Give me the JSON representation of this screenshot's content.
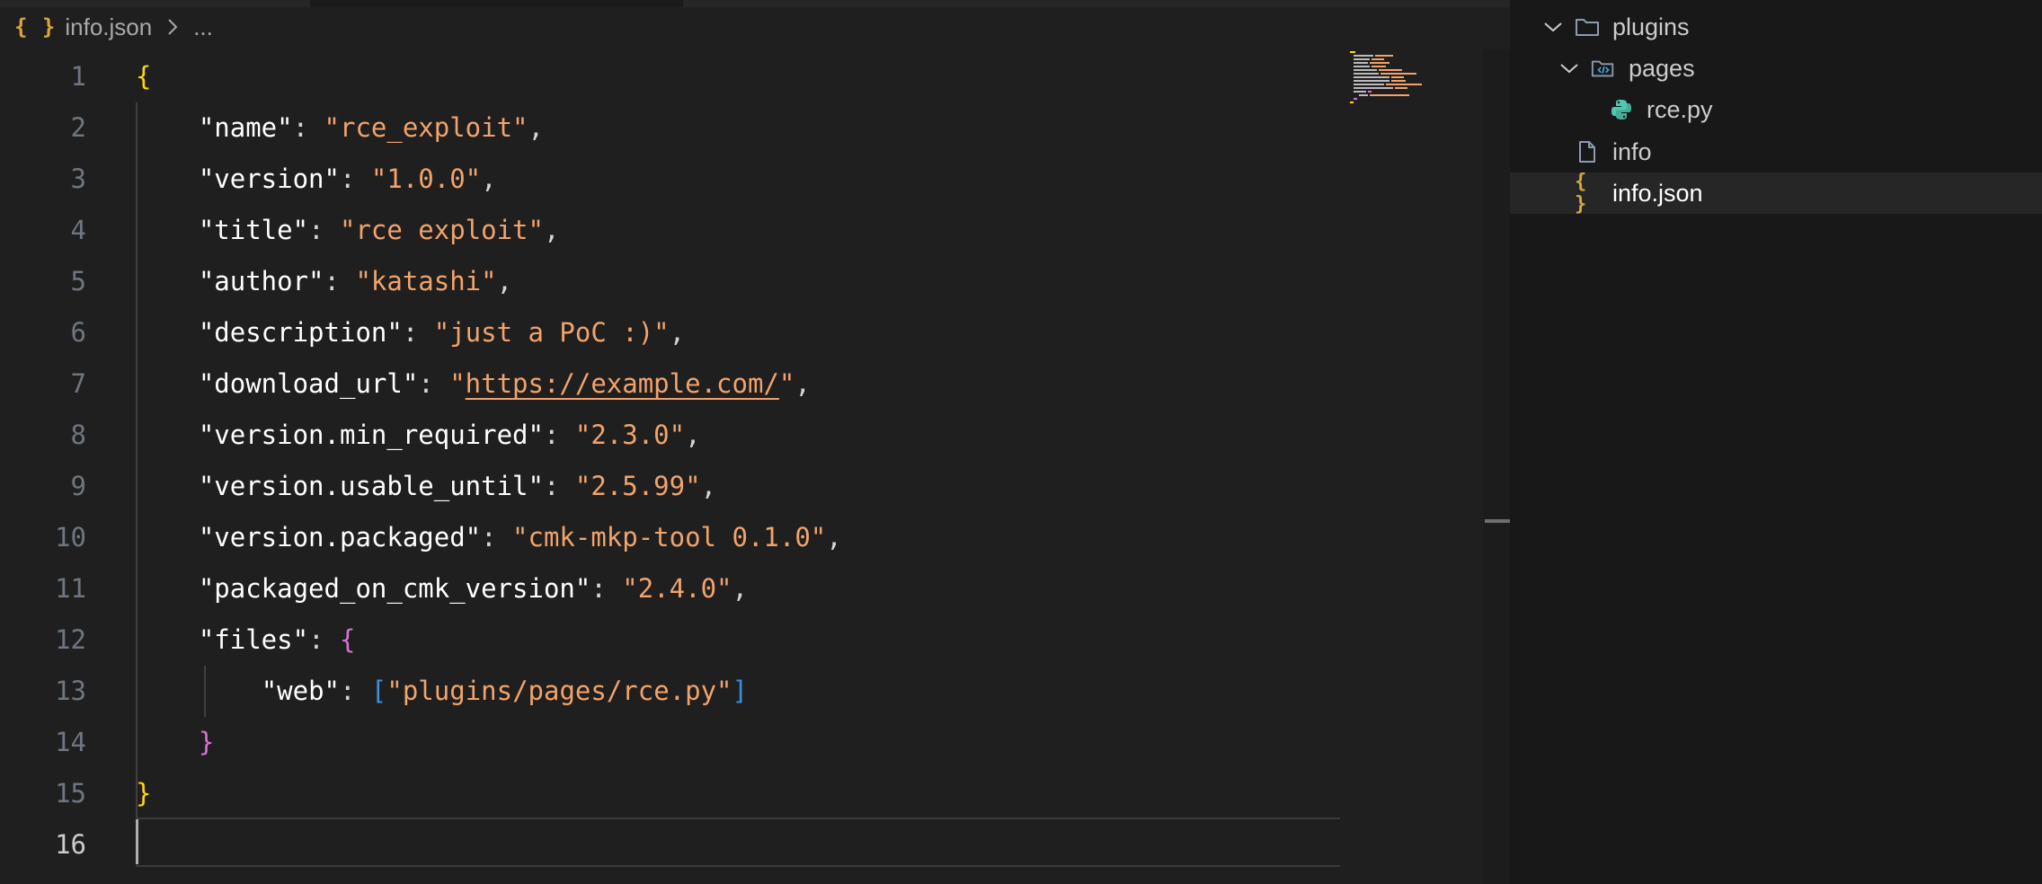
{
  "breadcrumb": {
    "file": "info.json",
    "more": "..."
  },
  "editor": {
    "line_numbers": [
      "1",
      "2",
      "3",
      "4",
      "5",
      "6",
      "7",
      "8",
      "9",
      "10",
      "11",
      "12",
      "13",
      "14",
      "15",
      "16"
    ],
    "active_line": "16",
    "lines": [
      [
        {
          "t": "{",
          "c": "b1"
        }
      ],
      [
        {
          "t": "    "
        },
        {
          "t": "\"name\"",
          "c": "k"
        },
        {
          "t": ": ",
          "c": "p"
        },
        {
          "t": "\"rce_exploit\"",
          "c": "s"
        },
        {
          "t": ",",
          "c": "p"
        }
      ],
      [
        {
          "t": "    "
        },
        {
          "t": "\"version\"",
          "c": "k"
        },
        {
          "t": ": ",
          "c": "p"
        },
        {
          "t": "\"1.0.0\"",
          "c": "s"
        },
        {
          "t": ",",
          "c": "p"
        }
      ],
      [
        {
          "t": "    "
        },
        {
          "t": "\"title\"",
          "c": "k"
        },
        {
          "t": ": ",
          "c": "p"
        },
        {
          "t": "\"rce exploit\"",
          "c": "s"
        },
        {
          "t": ",",
          "c": "p"
        }
      ],
      [
        {
          "t": "    "
        },
        {
          "t": "\"author\"",
          "c": "k"
        },
        {
          "t": ": ",
          "c": "p"
        },
        {
          "t": "\"katashi\"",
          "c": "s"
        },
        {
          "t": ",",
          "c": "p"
        }
      ],
      [
        {
          "t": "    "
        },
        {
          "t": "\"description\"",
          "c": "k"
        },
        {
          "t": ": ",
          "c": "p"
        },
        {
          "t": "\"just a PoC :)\"",
          "c": "s"
        },
        {
          "t": ",",
          "c": "p"
        }
      ],
      [
        {
          "t": "    "
        },
        {
          "t": "\"download_url\"",
          "c": "k"
        },
        {
          "t": ": ",
          "c": "p"
        },
        {
          "t": "\"",
          "c": "s"
        },
        {
          "t": "https://example.com/",
          "c": "s u",
          "link": true
        },
        {
          "t": "\"",
          "c": "s"
        },
        {
          "t": ",",
          "c": "p"
        }
      ],
      [
        {
          "t": "    "
        },
        {
          "t": "\"version.min_required\"",
          "c": "k"
        },
        {
          "t": ": ",
          "c": "p"
        },
        {
          "t": "\"2.3.0\"",
          "c": "s"
        },
        {
          "t": ",",
          "c": "p"
        }
      ],
      [
        {
          "t": "    "
        },
        {
          "t": "\"version.usable_until\"",
          "c": "k"
        },
        {
          "t": ": ",
          "c": "p"
        },
        {
          "t": "\"2.5.99\"",
          "c": "s"
        },
        {
          "t": ",",
          "c": "p"
        }
      ],
      [
        {
          "t": "    "
        },
        {
          "t": "\"version.packaged\"",
          "c": "k"
        },
        {
          "t": ": ",
          "c": "p"
        },
        {
          "t": "\"cmk-mkp-tool 0.1.0\"",
          "c": "s"
        },
        {
          "t": ",",
          "c": "p"
        }
      ],
      [
        {
          "t": "    "
        },
        {
          "t": "\"packaged_on_cmk_version\"",
          "c": "k"
        },
        {
          "t": ": ",
          "c": "p"
        },
        {
          "t": "\"2.4.0\"",
          "c": "s"
        },
        {
          "t": ",",
          "c": "p"
        }
      ],
      [
        {
          "t": "    "
        },
        {
          "t": "\"files\"",
          "c": "k"
        },
        {
          "t": ": ",
          "c": "p"
        },
        {
          "t": "{",
          "c": "b2"
        }
      ],
      [
        {
          "t": "        "
        },
        {
          "t": "\"web\"",
          "c": "k"
        },
        {
          "t": ": ",
          "c": "p"
        },
        {
          "t": "[",
          "c": "b3"
        },
        {
          "t": "\"plugins/pages/rce.py\"",
          "c": "s"
        },
        {
          "t": "]",
          "c": "b3"
        }
      ],
      [
        {
          "t": "    "
        },
        {
          "t": "}",
          "c": "b2"
        }
      ],
      [
        {
          "t": "}",
          "c": "b1"
        }
      ],
      []
    ]
  },
  "explorer": {
    "items": [
      {
        "label": "plugins",
        "icon": "folder-icon",
        "twist": "chevron-down-icon",
        "depth": 0
      },
      {
        "label": "pages",
        "icon": "code-folder-icon",
        "twist": "chevron-down-icon",
        "depth": 1
      },
      {
        "label": "rce.py",
        "icon": "python-icon",
        "twist": "",
        "depth": 2
      },
      {
        "label": "info",
        "icon": "file-icon",
        "twist": "",
        "depth": 0
      },
      {
        "label": "info.json",
        "icon": "json-icon",
        "twist": "",
        "depth": 0,
        "selected": true
      }
    ]
  },
  "colors": {
    "editor_bg": "#1f1f1f",
    "sidebar_bg": "#181818",
    "string": "#f2a36b",
    "key": "#ffffff",
    "brace_outer": "#ffd60a",
    "brace_inner": "#da70d6",
    "bracket": "#3d8fdb",
    "json_icon": "#d9a441",
    "python_icon": "#4ec9b0"
  }
}
